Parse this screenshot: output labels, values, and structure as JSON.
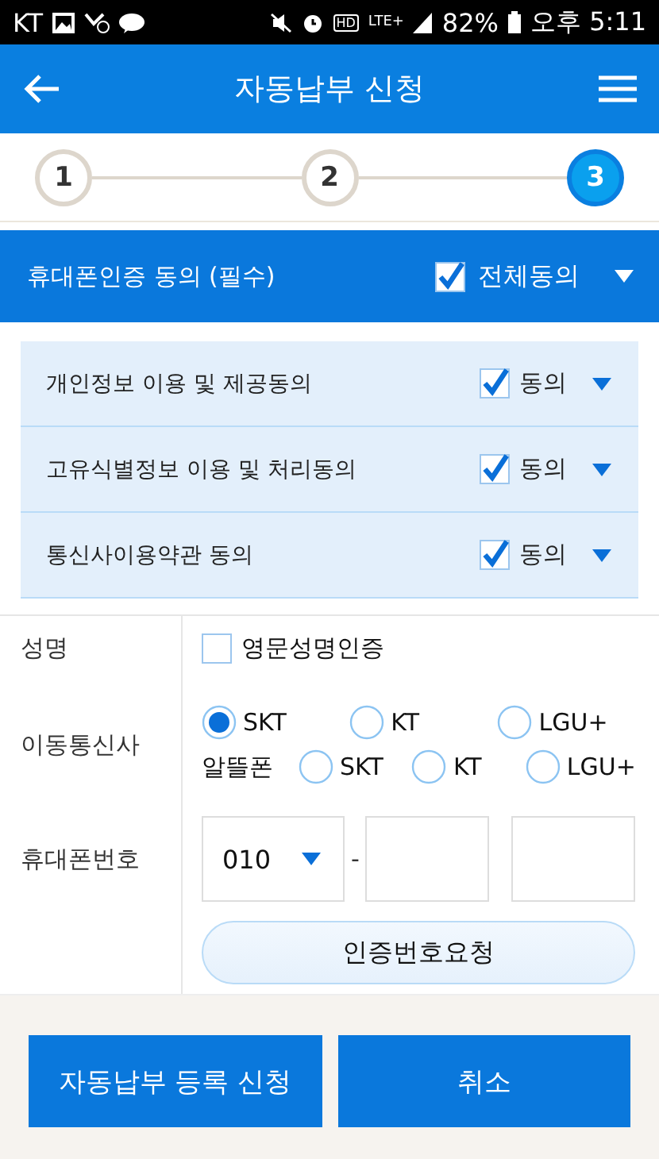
{
  "status_bar": {
    "carrier": "KT",
    "indicators": [
      "HD",
      "LTE+"
    ],
    "battery": "82%",
    "time": "오후 5:11"
  },
  "header": {
    "title": "자동납부 신청"
  },
  "steps": [
    {
      "label": "1",
      "selected": false
    },
    {
      "label": "2",
      "selected": false
    },
    {
      "label": "3",
      "selected": true
    }
  ],
  "consent": {
    "title": "휴대폰인증 동의 (필수)",
    "all": {
      "label": "전체동의",
      "checked": true
    },
    "items": [
      {
        "label": "개인정보 이용 및 제공동의",
        "agree": "동의",
        "checked": true
      },
      {
        "label": "고유식별정보 이용 및 처리동의",
        "agree": "동의",
        "checked": true
      },
      {
        "label": "통신사이용약관 동의",
        "agree": "동의",
        "checked": true
      }
    ]
  },
  "form": {
    "name": {
      "label": "성명",
      "option": {
        "label": "영문성명인증",
        "checked": false
      }
    },
    "carrier": {
      "label": "이동통신사",
      "options": [
        {
          "label": "SKT",
          "selected": true
        },
        {
          "label": "KT",
          "selected": false
        },
        {
          "label": "LGU+",
          "selected": false
        }
      ],
      "mvno_label": "알뜰폰",
      "mvno_options": [
        {
          "label": "SKT",
          "selected": false
        },
        {
          "label": "KT",
          "selected": false
        },
        {
          "label": "LGU+",
          "selected": false
        }
      ]
    },
    "phone": {
      "label": "휴대폰번호",
      "prefix": "010",
      "separator": "-"
    },
    "request_button": "인증번호요청"
  },
  "buttons": [
    {
      "label": "자동납부 등록 신청",
      "kind": "primary"
    },
    {
      "label": "취소",
      "kind": "primary"
    }
  ]
}
